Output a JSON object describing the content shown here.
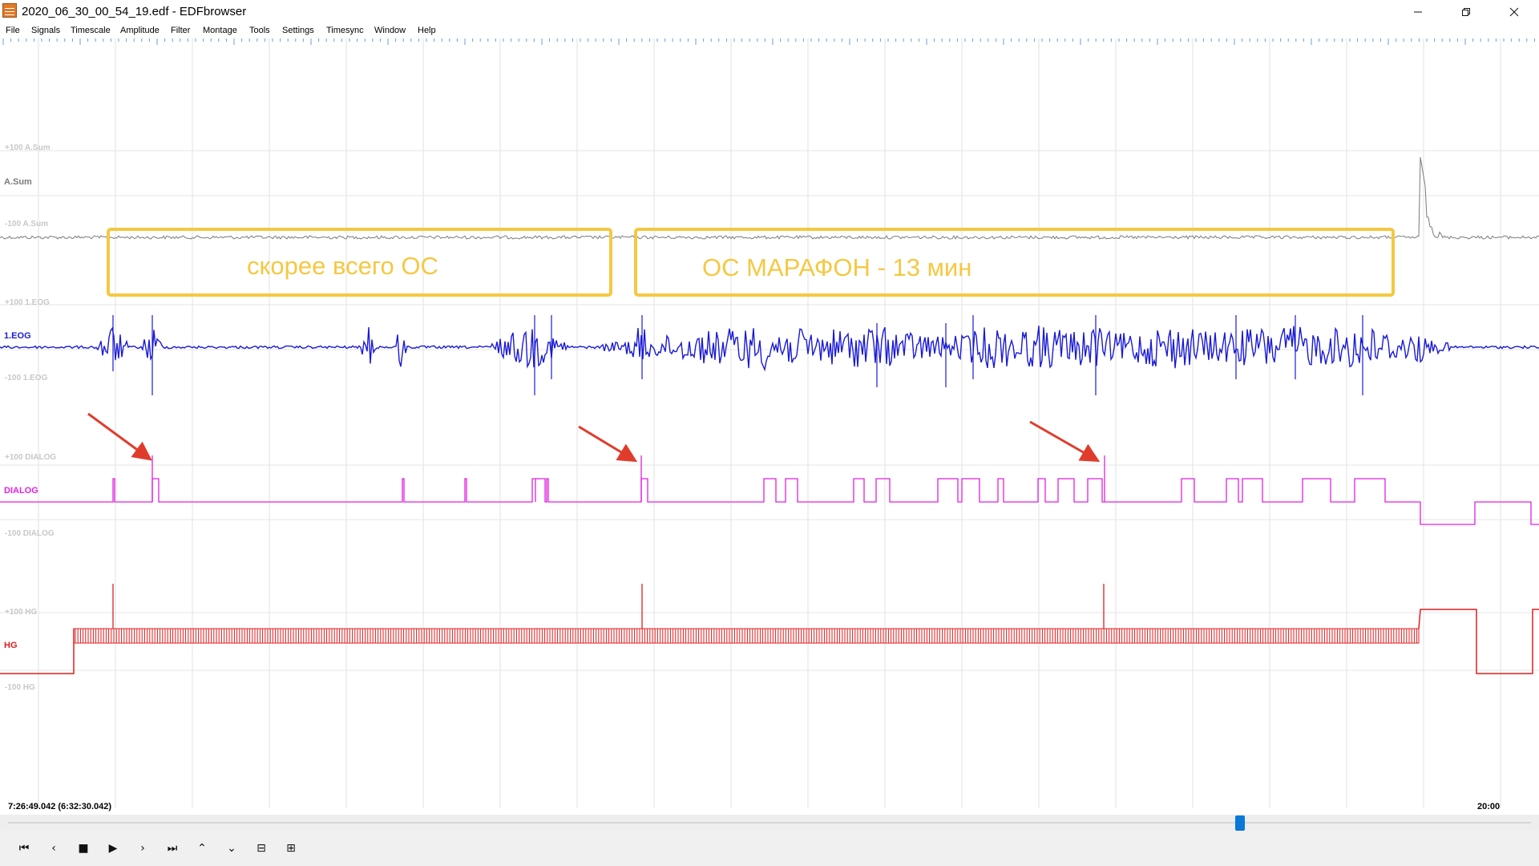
{
  "window": {
    "title": "2020_06_30_00_54_19.edf - EDFbrowser",
    "minimize_icon": "minimize-icon",
    "maximize_icon": "restore-icon",
    "close_icon": "close-icon"
  },
  "menu": {
    "items": [
      "File",
      "Signals",
      "Timescale",
      "Amplitude",
      "Filter",
      "Montage",
      "Tools",
      "Settings",
      "Timesync",
      "Window",
      "Help"
    ]
  },
  "signals": [
    {
      "name": "A.Sum",
      "scale_top": "+100 A.Sum",
      "scale_bottom": "-100 A.Sum",
      "color": "#7a7a7a"
    },
    {
      "name": "1.EOG",
      "scale_top": "+100 1.EOG",
      "scale_bottom": "-100 1.EOG",
      "color": "#1a1ad6"
    },
    {
      "name": "DIALOG",
      "scale_top": "+100 DIALOG",
      "scale_bottom": "-100 DIALOG",
      "color": "#e020e0"
    },
    {
      "name": "HG",
      "scale_top": "+100 HG",
      "scale_bottom": "-100 HG",
      "color": "#e01e1e"
    }
  ],
  "annotations": [
    {
      "text": "скорее всего ОС",
      "color": "#f5c842"
    },
    {
      "text": "ОС МАРАФОН - 13 мин",
      "color": "#f5c842"
    }
  ],
  "arrow_color": "#e03c2c",
  "timeline": {
    "current": "7:26:49.042 (6:32:30.042)",
    "end_label": "20:00"
  },
  "controls": [
    {
      "name": "go-start-icon",
      "glyph": "⏮"
    },
    {
      "name": "step-back-icon",
      "glyph": "‹"
    },
    {
      "name": "stop-icon",
      "glyph": "■"
    },
    {
      "name": "play-icon",
      "glyph": "▶"
    },
    {
      "name": "step-forward-icon",
      "glyph": "›"
    },
    {
      "name": "go-end-icon",
      "glyph": "⏭"
    },
    {
      "name": "scroll-up-icon",
      "glyph": "⌃"
    },
    {
      "name": "scroll-down-icon",
      "glyph": "⌄"
    },
    {
      "name": "zoom-out-icon",
      "glyph": "⊟"
    },
    {
      "name": "zoom-in-icon",
      "glyph": "⊞"
    }
  ]
}
